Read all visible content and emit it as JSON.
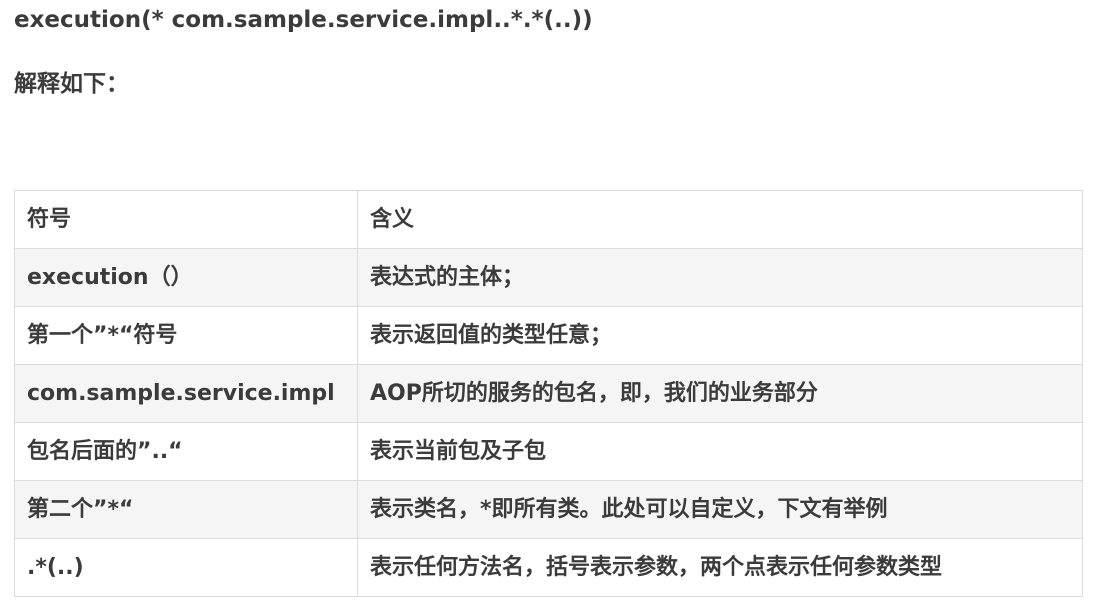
{
  "expression": "execution(* com.sample.service.impl..*.*(..))",
  "explain_heading": "解释如下：",
  "table": {
    "headers": [
      "符号",
      "含义"
    ],
    "rows": [
      [
        "execution（）",
        "表达式的主体；"
      ],
      [
        "第一个”*“符号",
        "表示返回值的类型任意；"
      ],
      [
        "com.sample.service.impl",
        "AOP所切的服务的包名，即，我们的业务部分"
      ],
      [
        "包名后面的”..“",
        "表示当前包及子包"
      ],
      [
        "第二个”*“",
        "表示类名，*即所有类。此处可以自定义，下文有举例"
      ],
      [
        ".*(..)",
        "表示任何方法名，括号表示参数，两个点表示任何参数类型"
      ]
    ]
  }
}
